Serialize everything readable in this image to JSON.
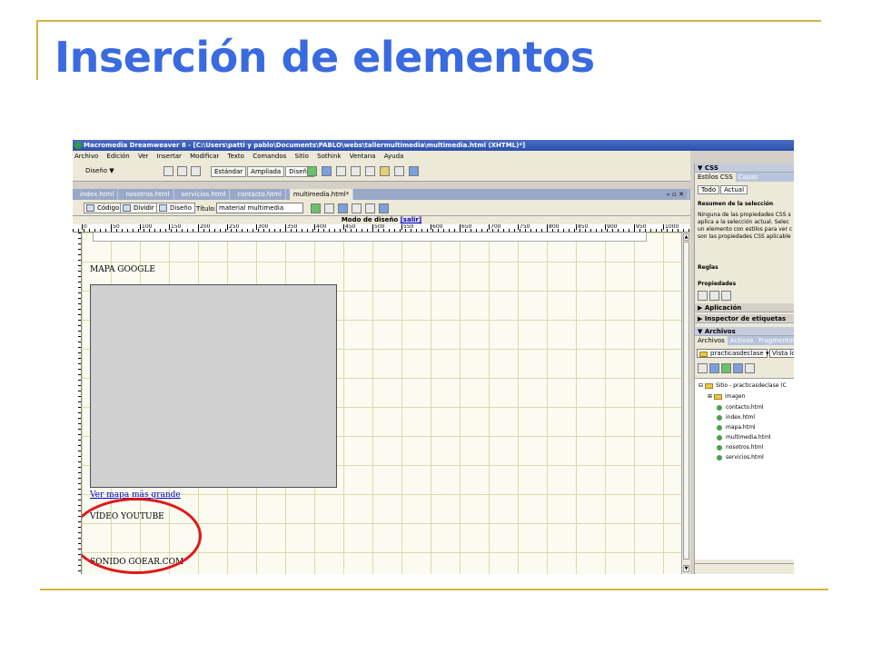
{
  "slide": {
    "title": "Inserción de elementos",
    "accent_color": "#3a6ae0",
    "line_color": "#d4b440"
  },
  "window": {
    "title": "Macromedia Dreamweaver 8 - [C:\\Users\\patti y pablo\\Documents\\PABLO\\webs\\tallermultimedia\\multimedia.html (XHTML)*]"
  },
  "menu": [
    "Archivo",
    "Edición",
    "Ver",
    "Insertar",
    "Modificar",
    "Texto",
    "Comandos",
    "Sitio",
    "Sothink",
    "Ventana",
    "Ayuda"
  ],
  "insert_bar": {
    "mode_label": "Diseño ▼",
    "views": [
      "Estándar",
      "Ampliada",
      "Diseño"
    ]
  },
  "doc_tabs": [
    "index.html",
    "nosotros.html",
    "servicios.html",
    "contacto.html",
    "multimedia.html*"
  ],
  "doc_toolbar": {
    "code_label": "Código",
    "split_label": "Dividir",
    "design_label": "Diseño",
    "title_label": "Título:",
    "title_value": "material multimedia"
  },
  "design_mode": {
    "label": "Modo de diseño",
    "exit_link": "[salir]"
  },
  "ruler_labels": [
    "0",
    "50",
    "100",
    "150",
    "200",
    "250",
    "300",
    "350",
    "400",
    "450",
    "500",
    "550",
    "600",
    "650",
    "700",
    "750",
    "800",
    "850",
    "900",
    "950",
    "1000"
  ],
  "canvas": {
    "map_heading": "MAPA GOOGLE",
    "map_link": "Ver mapa más grande",
    "video_heading": "VÍDEO YOUTUBE",
    "sound_heading": "SONIDO GOEAR.COM",
    "highlight_color": "#e01818"
  },
  "panel": {
    "css_header": "▼ CSS",
    "css_tabs": [
      "Estilos CSS",
      "Capas"
    ],
    "css_subtabs": [
      "Todo",
      "Actual"
    ],
    "selection_summary_title": "Resumen de la selección",
    "selection_summary_lines": [
      "Ninguna de las propiedades CSS s",
      "aplica a la selección actual. Selec",
      "un elemento con estilos para ver c",
      "son las propiedades CSS aplicable"
    ],
    "rules_label": "Reglas",
    "properties_label": "Propiedades",
    "application_label": "▶ Aplicación",
    "tag_inspector_label": "▶ Inspector de etiquetas",
    "files_header": "▼ Archivos",
    "files_tabs": [
      "Archivos",
      "Activos",
      "Fragmentos"
    ],
    "site_select": "practicasdeclase",
    "view_select": "Vista lo",
    "site_root": "Sitio - practicasdeclase (C",
    "folder": "imagen",
    "files": [
      "contacto.html",
      "index.html",
      "mapa.html",
      "multimedia.html",
      "nosotros.html",
      "servicios.html"
    ]
  }
}
